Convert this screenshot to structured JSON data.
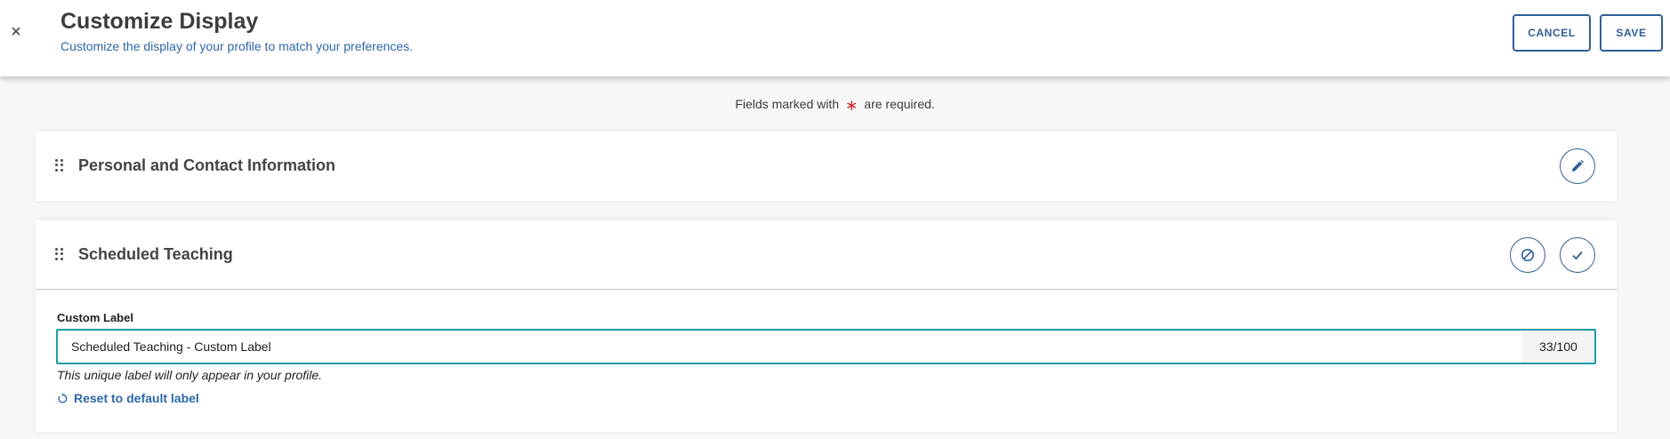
{
  "header": {
    "close_glyph": "×",
    "title": "Customize Display",
    "subtitle": "Customize the display of your profile to match your preferences.",
    "cancel_label": "CANCEL",
    "save_label": "SAVE"
  },
  "required_note": {
    "before": "Fields marked with",
    "star": "∗",
    "after": "are required."
  },
  "sections": [
    {
      "title": "Personal and Contact Information",
      "actions": [
        "pencil-icon"
      ]
    },
    {
      "title": "Scheduled Teaching",
      "actions": [
        "cancel-circle-icon",
        "checkmark-icon"
      ],
      "field": {
        "label": "Custom Label",
        "value": "Scheduled Teaching - Custom Label",
        "counter": "33/100",
        "help": "This unique label will only appear in your profile.",
        "reset_label": "Reset to default label"
      }
    }
  ],
  "colors": {
    "accent": "#2e5f96",
    "focus": "#1f9ba6",
    "link": "#2e67a8",
    "required": "#d9262b"
  }
}
